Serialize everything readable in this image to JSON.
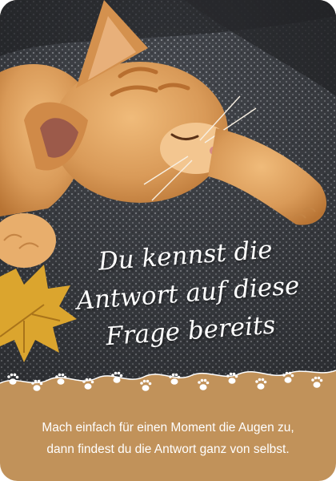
{
  "headline": {
    "line1": "Du kennst die",
    "line2": "Antwort auf diese",
    "line3": "Frage bereits"
  },
  "caption": {
    "line1": "Mach einfach für einen Moment die Augen zu,",
    "line2": "dann findest du die Antwort ganz von selbst."
  },
  "colors": {
    "bottom_panel": "#c1925a",
    "blanket": "#3e4046",
    "kitten": "#e0a05c",
    "leaf": "#dba52e",
    "text": "#ffffff"
  },
  "icons": [
    "paw-print-icon",
    "maple-leaf-icon"
  ]
}
